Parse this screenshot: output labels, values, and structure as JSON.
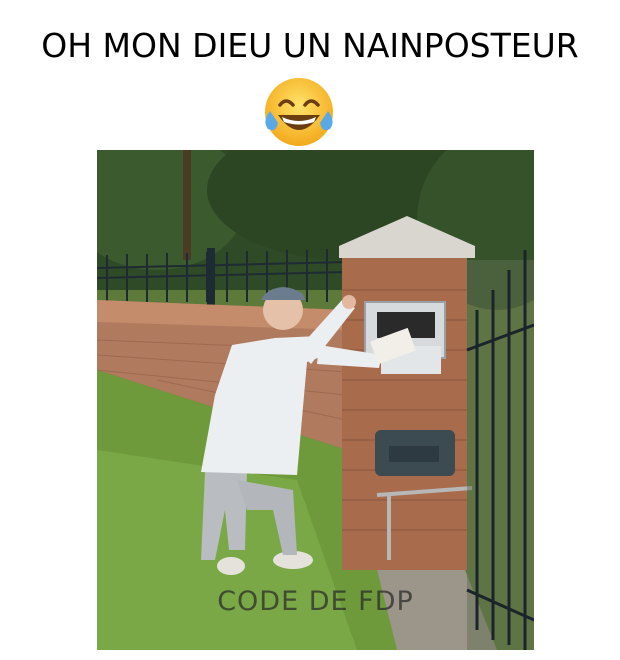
{
  "meme": {
    "caption": "OH MON DIEU UN NAINPOSTEUR",
    "emoji": "face-with-tears-of-joy",
    "watermark": "CODE DE FDP"
  },
  "colors": {
    "background": "#ffffff",
    "caption_text": "#000000",
    "emoji_yellow": "#f7c12a",
    "emoji_tears": "#5aa9e6"
  }
}
